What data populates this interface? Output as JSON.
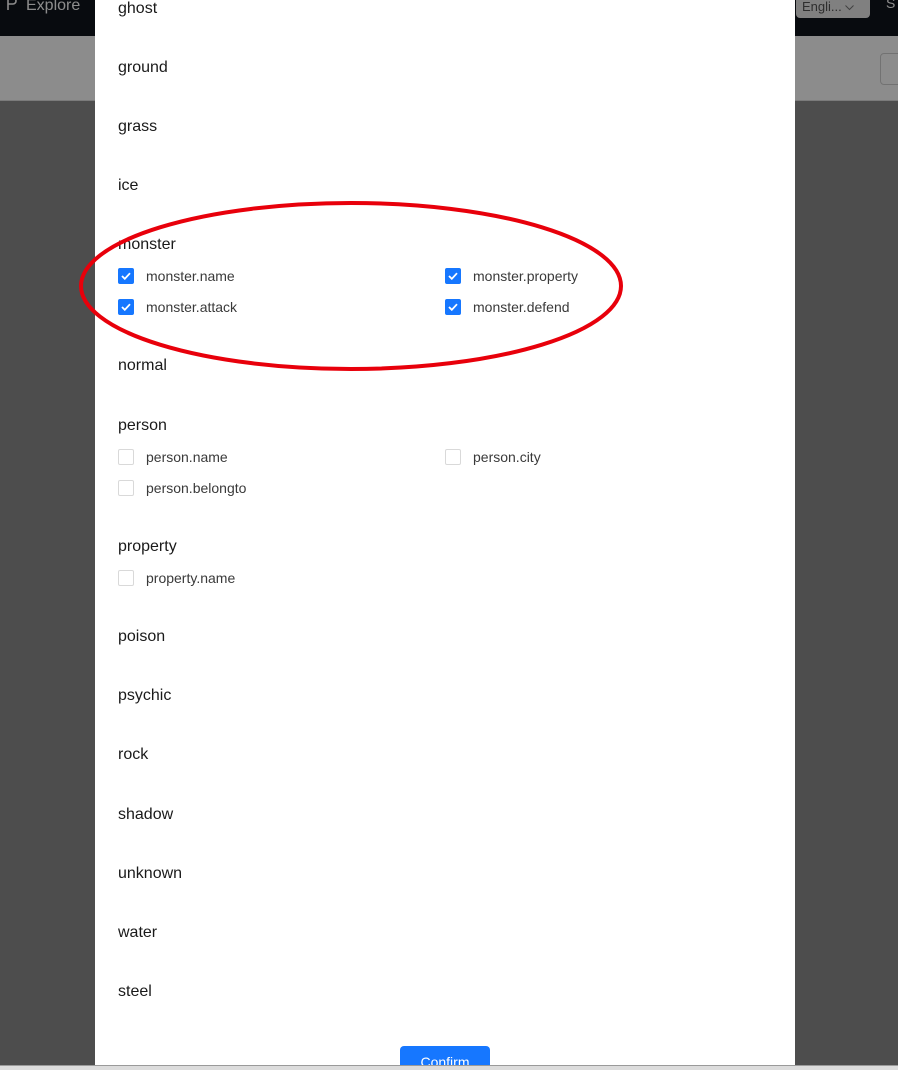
{
  "background": {
    "nav_explore_label": "Explore",
    "language_select_value": "Engli...",
    "top_right_cut_text": "S"
  },
  "modal": {
    "groups": [
      {
        "title": "ghost"
      },
      {
        "title": "ground"
      },
      {
        "title": "grass"
      },
      {
        "title": "ice"
      },
      {
        "title": "monster",
        "properties": [
          {
            "label": "monster.name",
            "checked": true
          },
          {
            "label": "monster.property",
            "checked": true
          },
          {
            "label": "monster.attack",
            "checked": true
          },
          {
            "label": "monster.defend",
            "checked": true
          }
        ]
      },
      {
        "title": "normal"
      },
      {
        "title": "person",
        "properties": [
          {
            "label": "person.name",
            "checked": false
          },
          {
            "label": "person.city",
            "checked": false
          },
          {
            "label": "person.belongto",
            "checked": false
          }
        ]
      },
      {
        "title": "property",
        "properties": [
          {
            "label": "property.name",
            "checked": false
          }
        ]
      },
      {
        "title": "poison"
      },
      {
        "title": "psychic"
      },
      {
        "title": "rock"
      },
      {
        "title": "shadow"
      },
      {
        "title": "unknown"
      },
      {
        "title": "water"
      },
      {
        "title": "steel"
      }
    ],
    "confirm_label": "Confirm"
  },
  "colors": {
    "accent": "#1677ff",
    "annotation": "#e8000b",
    "topbar": "#10141c"
  }
}
